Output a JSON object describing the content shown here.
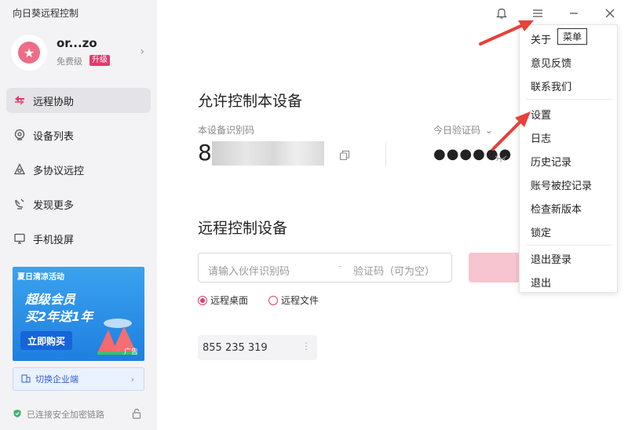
{
  "app": {
    "title": "向日葵远程控制"
  },
  "user": {
    "name": "or...zo",
    "level": "免费级",
    "upgrade": "升级"
  },
  "nav": {
    "items": [
      {
        "label": "远程协助",
        "icon": "remote-assist-icon",
        "active": true
      },
      {
        "label": "设备列表",
        "icon": "device-list-icon",
        "active": false
      },
      {
        "label": "多协议远控",
        "icon": "multi-protocol-icon",
        "active": false
      },
      {
        "label": "发现更多",
        "icon": "discover-icon",
        "active": false
      },
      {
        "label": "手机投屏",
        "icon": "screen-cast-icon",
        "active": false
      }
    ]
  },
  "promo": {
    "tag": "夏日清凉活动",
    "line1": "超级会员",
    "line2": "买2年送1年",
    "button": "立即购买",
    "ad": "广告"
  },
  "enterprise": {
    "label": "切换企业端"
  },
  "security": {
    "label": "已连接安全加密链路"
  },
  "allow": {
    "title": "允许控制本设备",
    "device_id_label": "本设备识别码",
    "device_id_prefix": "8",
    "code_label": "今日验证码",
    "code_masked": "●●●●●●"
  },
  "remote": {
    "title": "远程控制设备",
    "partner_placeholder": "请输入伙伴识别码",
    "code_placeholder": "验证码（可为空）",
    "radio_desktop": "远程桌面",
    "radio_file": "远程文件",
    "history_id": "855 235 319"
  },
  "menu": {
    "badge": "菜单",
    "items": [
      "关于",
      "意见反馈",
      "联系我们",
      "设置",
      "日志",
      "历史记录",
      "账号被控记录",
      "检查新版本",
      "锁定",
      "退出登录",
      "退出"
    ]
  },
  "colors": {
    "accent": "#e23b6b",
    "arrow": "#e8403a",
    "sidebar": "#f3f3f5"
  }
}
